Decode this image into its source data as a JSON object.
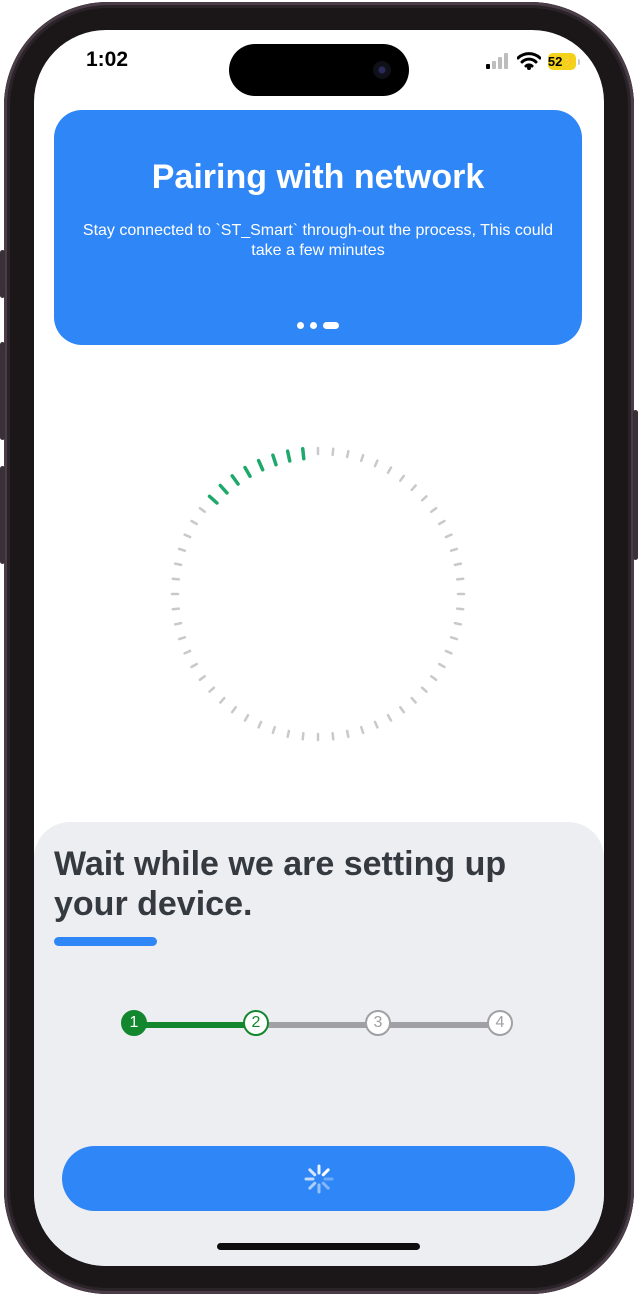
{
  "status_bar": {
    "time": "1:02",
    "battery": "52"
  },
  "banner": {
    "title": "Pairing with network",
    "subtitle": "Stay connected to `ST_Smart` through-out the process, This could take a few minutes",
    "page_count": 3,
    "active_page": 3
  },
  "progress": {
    "completed_fraction": 0.13
  },
  "setup": {
    "heading": "Wait while we are setting up your device.",
    "steps": [
      "1",
      "2",
      "3",
      "4"
    ],
    "current_step": 2
  },
  "colors": {
    "accent": "#2f86f6",
    "success": "#13872e",
    "inactive": "#a0a0a5",
    "ring_done": "#1fa86b",
    "ring_pending": "#c9c9cb"
  },
  "icons": {
    "signal": "cellular-signal-icon",
    "wifi": "wifi-icon",
    "battery": "battery-charging-icon",
    "button": "loading-spinner-icon"
  }
}
